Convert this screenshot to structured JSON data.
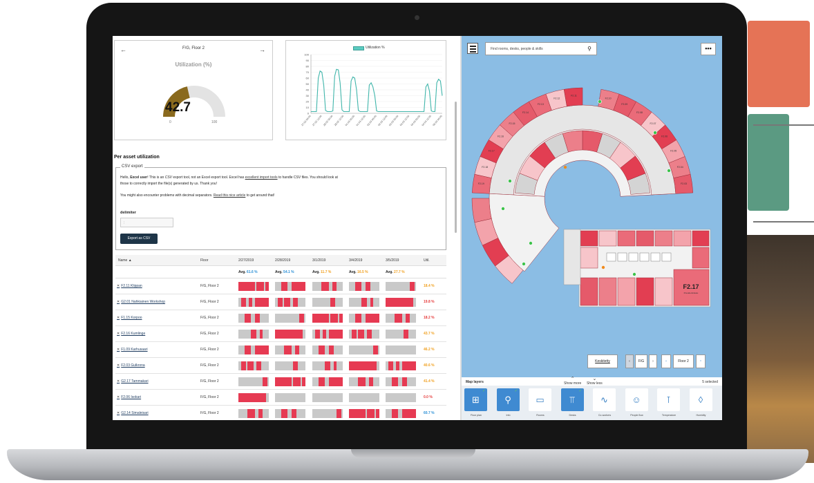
{
  "gauge_card": {
    "prev_arrow": "←",
    "next_arrow": "→",
    "title": "F/G, Floor 2",
    "label": "Utilization (%)",
    "value": "42.7",
    "value_num": 42.7,
    "min": "0",
    "max": "100",
    "fill_color": "#8a6a1e"
  },
  "line_chart": {
    "legend": "Utilization %"
  },
  "chart_data": {
    "type": "line",
    "title": "",
    "xlabel": "",
    "ylabel": "",
    "ylim": [
      0,
      100
    ],
    "y_ticks": [
      "0",
      "10",
      "20",
      "30",
      "40",
      "50",
      "60",
      "70",
      "80",
      "90",
      "100"
    ],
    "x_tick_labels": [
      "27.02 00:00",
      "27.02 12:00",
      "28.02 00:00",
      "28.02 12:00",
      "01.03 00:00",
      "01.03 12:00",
      "02.03 00:00",
      "02.03 12:00",
      "03.03 00:00",
      "03.03 12:00",
      "04.03 00:00",
      "04.03 12:00",
      "05.03 00:00"
    ],
    "series": [
      {
        "name": "Utilization %",
        "color": "#3fb5aa",
        "x": [
          0,
          3,
          6,
          9,
          12,
          15,
          18,
          21,
          24,
          27,
          30,
          33,
          36,
          39,
          42,
          45,
          48,
          51,
          54,
          57,
          60,
          63,
          66,
          69,
          72,
          75,
          78,
          81,
          84,
          87,
          90,
          93,
          96,
          99,
          102,
          105,
          108,
          111,
          114,
          117,
          120,
          123,
          126,
          129,
          132,
          135,
          138,
          141,
          144,
          147,
          150,
          153,
          156,
          159,
          162,
          165,
          168,
          171,
          174,
          177,
          180,
          183,
          186,
          189,
          192,
          195,
          198,
          201,
          204,
          207,
          210,
          213,
          216
        ],
        "values": [
          3,
          3,
          3,
          3,
          60,
          72,
          70,
          48,
          5,
          3,
          3,
          3,
          4,
          63,
          75,
          74,
          52,
          6,
          3,
          3,
          3,
          3,
          55,
          62,
          60,
          40,
          5,
          3,
          3,
          3,
          3,
          3,
          48,
          52,
          45,
          30,
          4,
          3,
          3,
          3,
          3,
          3,
          3,
          3,
          3,
          3,
          3,
          3,
          3,
          3,
          3,
          3,
          3,
          3,
          3,
          3,
          3,
          3,
          3,
          3,
          3,
          3,
          3,
          45,
          50,
          38,
          4,
          3,
          3,
          52,
          58,
          55,
          30
        ]
      }
    ]
  },
  "section": {
    "title": "Per asset utilization"
  },
  "csv": {
    "legend": "CSV export",
    "line1_pre": "Hello, ",
    "line1_bold": "Excel user",
    "line1_mid": "! This is an ",
    "line1_em": "CSV",
    "line1_mid2": " export tool, not an Excel export tool. Excel has ",
    "line1_link": "excellent import tools",
    "line1_post": " to handle CSV files. You should look at",
    "line2": "those to correctly import the file(s) generated by us. Thank you!",
    "line3_pre": "You might also encounter problems with decimal separators. ",
    "line3_link": "Read this nice article",
    "line3_post": " to get around that!",
    "delimiter_label": "delimiter",
    "delimiter_value": ";",
    "export_button": "Export as CSV"
  },
  "table": {
    "headers": {
      "name": "Name ▲",
      "floor": "Floor",
      "util": "Util."
    },
    "dates": [
      "2/27/2019",
      "2/28/2019",
      "3/1/2019",
      "3/4/2019",
      "3/5/2019"
    ],
    "averages": [
      {
        "label": "Avg. ",
        "value": "61.6 %",
        "color": "#2a8fd6"
      },
      {
        "label": "Avg. ",
        "value": "54.1 %",
        "color": "#2a8fd6"
      },
      {
        "label": "Avg. ",
        "value": "11.7 %",
        "color": "#f0a020"
      },
      {
        "label": "Avg. ",
        "value": "16.5 %",
        "color": "#f0a020"
      },
      {
        "label": "Avg. ",
        "value": "27.7 %",
        "color": "#f0a020"
      }
    ],
    "rows": [
      {
        "name": "F2.11 Klippan",
        "floor": "F/G, Floor 2",
        "util": "18.4 %",
        "util_color": "#f0a020"
      },
      {
        "name": "G2.01 Nahkiainen Workshop",
        "floor": "F/G, Floor 2",
        "util": "19.8 %",
        "util_color": "#e63a3a"
      },
      {
        "name": "F1.15 Korpoo",
        "floor": "F/G, Floor 2",
        "util": "18.2 %",
        "util_color": "#e63a3a"
      },
      {
        "name": "F2.16 Kumlinge",
        "floor": "F/G, Floor 2",
        "util": "43.7 %",
        "util_color": "#f0a020"
      },
      {
        "name": "F1.09 Karhusaari",
        "floor": "F/G, Floor 2",
        "util": "46.2 %",
        "util_color": "#f0a020"
      },
      {
        "name": "F2.03 Gulkrona",
        "floor": "F/G, Floor 2",
        "util": "40.6 %",
        "util_color": "#f0a020"
      },
      {
        "name": "G2.17 Tammakari",
        "floor": "F/G, Floor 2",
        "util": "41.4 %",
        "util_color": "#f0a020"
      },
      {
        "name": "F2.06 Isokari",
        "floor": "F/G, Floor 2",
        "util": "0.0 %",
        "util_color": "#e63a3a"
      },
      {
        "name": "G2.14 Simaleisari",
        "floor": "F/G, Floor 2",
        "util": "60.7 %",
        "util_color": "#2a8fd6"
      }
    ]
  },
  "map": {
    "search_placeholder": "Find rooms, desks, people & skills",
    "search_icon": "magnifier",
    "more_label": "•••",
    "room_label_large": "F2.17",
    "room_label_sub": "Presidentinkatu",
    "room_labels": [
      "F2.03",
      "F2.04",
      "F2.05",
      "F2.06",
      "F2.07",
      "F2.08",
      "F2.09",
      "F2.10",
      "F2.11",
      "F2.12",
      "F2.13",
      "F2.14",
      "F2.15",
      "F2.16",
      "F2.17",
      "F2.18",
      "F2.19",
      "F2.20",
      "F2.21",
      "F2.22",
      "F2.23",
      "F2.24",
      "F2.25",
      "F2.26",
      "F2.27"
    ],
    "controls": {
      "reset": "Keskitetty",
      "building": "F/G",
      "floor": "Floor 2",
      "prev": "‹",
      "next": "›",
      "down": "⌄",
      "up": "⌃"
    }
  },
  "layers": {
    "title": "Map layers",
    "show_more": "Show more",
    "show_less": "Show less",
    "selected": "5 selected",
    "items": [
      {
        "caption": "Floor plan",
        "icon": "floorplan-icon",
        "active": true
      },
      {
        "caption": "Info",
        "icon": "pin-icon",
        "active": true
      },
      {
        "caption": "Rooms",
        "icon": "monitor-icon",
        "active": false
      },
      {
        "caption": "Desks",
        "icon": "desk-icon",
        "active": true
      },
      {
        "caption": "Co-workers",
        "icon": "activity-icon",
        "active": false
      },
      {
        "caption": "People flow",
        "icon": "people-icon",
        "active": false
      },
      {
        "caption": "Temperature",
        "icon": "thermometer-icon",
        "active": false
      },
      {
        "caption": "Humidity",
        "icon": "drop-icon",
        "active": false
      }
    ]
  }
}
